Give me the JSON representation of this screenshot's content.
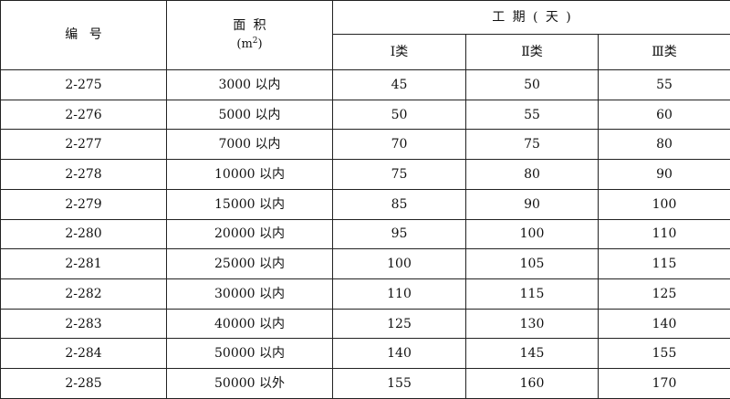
{
  "table": {
    "headers": {
      "code": "编号",
      "area": "面积",
      "area_unit_prefix": "(m",
      "area_unit_sup": "2",
      "area_unit_suffix": ")",
      "duration": "工期(天)",
      "class_1": "Ⅰ类",
      "class_2": "Ⅱ类",
      "class_3": "Ⅲ类"
    },
    "rows": [
      {
        "code": "2-275",
        "area": "3000 以内",
        "d1": "45",
        "d2": "50",
        "d3": "55"
      },
      {
        "code": "2-276",
        "area": "5000 以内",
        "d1": "50",
        "d2": "55",
        "d3": "60"
      },
      {
        "code": "2-277",
        "area": "7000 以内",
        "d1": "70",
        "d2": "75",
        "d3": "80"
      },
      {
        "code": "2-278",
        "area": "10000 以内",
        "d1": "75",
        "d2": "80",
        "d3": "90"
      },
      {
        "code": "2-279",
        "area": "15000 以内",
        "d1": "85",
        "d2": "90",
        "d3": "100"
      },
      {
        "code": "2-280",
        "area": "20000 以内",
        "d1": "95",
        "d2": "100",
        "d3": "110"
      },
      {
        "code": "2-281",
        "area": "25000 以内",
        "d1": "100",
        "d2": "105",
        "d3": "115"
      },
      {
        "code": "2-282",
        "area": "30000 以内",
        "d1": "110",
        "d2": "115",
        "d3": "125"
      },
      {
        "code": "2-283",
        "area": "40000 以内",
        "d1": "125",
        "d2": "130",
        "d3": "140"
      },
      {
        "code": "2-284",
        "area": "50000 以内",
        "d1": "140",
        "d2": "145",
        "d3": "155"
      },
      {
        "code": "2-285",
        "area": "50000 以外",
        "d1": "155",
        "d2": "160",
        "d3": "170"
      }
    ]
  }
}
